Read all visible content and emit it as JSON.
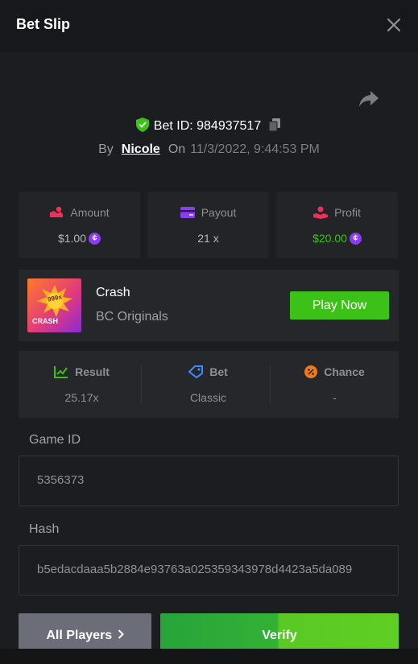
{
  "header": {
    "title": "Bet Slip"
  },
  "bet": {
    "id_label": "Bet ID: 984937517",
    "by_label": "By",
    "user": "Nicole",
    "on_label": "On",
    "datetime": "11/3/2022, 9:44:53 PM"
  },
  "stats": [
    {
      "label": "Amount",
      "value": "$1.00",
      "icon": "amount-icon"
    },
    {
      "label": "Payout",
      "value": "21 x",
      "icon": "payout-card-icon"
    },
    {
      "label": "Profit",
      "value": "$20.00",
      "icon": "profit-hand-icon"
    }
  ],
  "game": {
    "name": "Crash",
    "provider": "BC Originals",
    "thumb_badge": "999x",
    "thumb_label": "CRASH",
    "play_label": "Play Now"
  },
  "result": [
    {
      "label": "Result",
      "value": "25.17x",
      "icon": "result-chart-icon"
    },
    {
      "label": "Bet",
      "value": "Classic",
      "icon": "bet-tag-icon"
    },
    {
      "label": "Chance",
      "value": "-",
      "icon": "percent-icon"
    }
  ],
  "fields": {
    "game_id_label": "Game ID",
    "game_id_value": "5356373",
    "hash_label": "Hash",
    "hash_value": "b5edacdaaa5b2884e93763a025359343978d4423a5da089"
  },
  "actions": {
    "players_label": "All Players",
    "verify_label": "Verify"
  },
  "colors": {
    "accent_green": "#3bc117",
    "coin_purple": "#8a3ef0",
    "profit_green": "#3bc117",
    "background": "#1c1d21"
  }
}
